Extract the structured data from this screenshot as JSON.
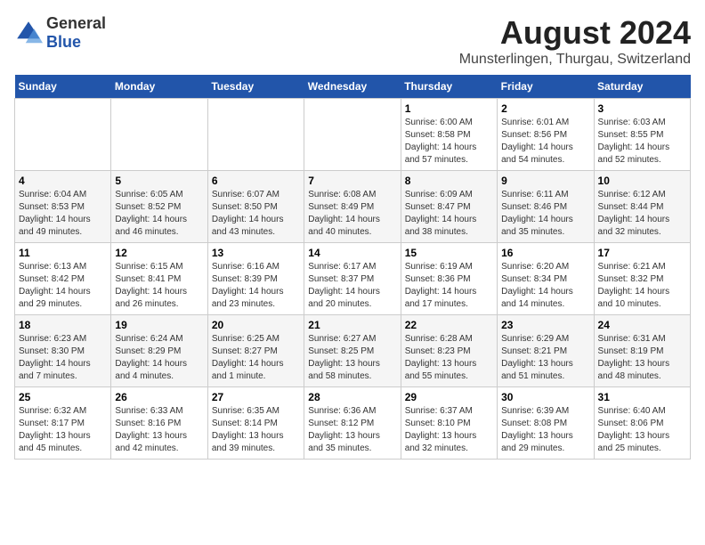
{
  "header": {
    "logo_general": "General",
    "logo_blue": "Blue",
    "title": "August 2024",
    "subtitle": "Munsterlingen, Thurgau, Switzerland"
  },
  "days_of_week": [
    "Sunday",
    "Monday",
    "Tuesday",
    "Wednesday",
    "Thursday",
    "Friday",
    "Saturday"
  ],
  "weeks": [
    [
      {
        "day": "",
        "info": ""
      },
      {
        "day": "",
        "info": ""
      },
      {
        "day": "",
        "info": ""
      },
      {
        "day": "",
        "info": ""
      },
      {
        "day": "1",
        "info": "Sunrise: 6:00 AM\nSunset: 8:58 PM\nDaylight: 14 hours\nand 57 minutes."
      },
      {
        "day": "2",
        "info": "Sunrise: 6:01 AM\nSunset: 8:56 PM\nDaylight: 14 hours\nand 54 minutes."
      },
      {
        "day": "3",
        "info": "Sunrise: 6:03 AM\nSunset: 8:55 PM\nDaylight: 14 hours\nand 52 minutes."
      }
    ],
    [
      {
        "day": "4",
        "info": "Sunrise: 6:04 AM\nSunset: 8:53 PM\nDaylight: 14 hours\nand 49 minutes."
      },
      {
        "day": "5",
        "info": "Sunrise: 6:05 AM\nSunset: 8:52 PM\nDaylight: 14 hours\nand 46 minutes."
      },
      {
        "day": "6",
        "info": "Sunrise: 6:07 AM\nSunset: 8:50 PM\nDaylight: 14 hours\nand 43 minutes."
      },
      {
        "day": "7",
        "info": "Sunrise: 6:08 AM\nSunset: 8:49 PM\nDaylight: 14 hours\nand 40 minutes."
      },
      {
        "day": "8",
        "info": "Sunrise: 6:09 AM\nSunset: 8:47 PM\nDaylight: 14 hours\nand 38 minutes."
      },
      {
        "day": "9",
        "info": "Sunrise: 6:11 AM\nSunset: 8:46 PM\nDaylight: 14 hours\nand 35 minutes."
      },
      {
        "day": "10",
        "info": "Sunrise: 6:12 AM\nSunset: 8:44 PM\nDaylight: 14 hours\nand 32 minutes."
      }
    ],
    [
      {
        "day": "11",
        "info": "Sunrise: 6:13 AM\nSunset: 8:42 PM\nDaylight: 14 hours\nand 29 minutes."
      },
      {
        "day": "12",
        "info": "Sunrise: 6:15 AM\nSunset: 8:41 PM\nDaylight: 14 hours\nand 26 minutes."
      },
      {
        "day": "13",
        "info": "Sunrise: 6:16 AM\nSunset: 8:39 PM\nDaylight: 14 hours\nand 23 minutes."
      },
      {
        "day": "14",
        "info": "Sunrise: 6:17 AM\nSunset: 8:37 PM\nDaylight: 14 hours\nand 20 minutes."
      },
      {
        "day": "15",
        "info": "Sunrise: 6:19 AM\nSunset: 8:36 PM\nDaylight: 14 hours\nand 17 minutes."
      },
      {
        "day": "16",
        "info": "Sunrise: 6:20 AM\nSunset: 8:34 PM\nDaylight: 14 hours\nand 14 minutes."
      },
      {
        "day": "17",
        "info": "Sunrise: 6:21 AM\nSunset: 8:32 PM\nDaylight: 14 hours\nand 10 minutes."
      }
    ],
    [
      {
        "day": "18",
        "info": "Sunrise: 6:23 AM\nSunset: 8:30 PM\nDaylight: 14 hours\nand 7 minutes."
      },
      {
        "day": "19",
        "info": "Sunrise: 6:24 AM\nSunset: 8:29 PM\nDaylight: 14 hours\nand 4 minutes."
      },
      {
        "day": "20",
        "info": "Sunrise: 6:25 AM\nSunset: 8:27 PM\nDaylight: 14 hours\nand 1 minute."
      },
      {
        "day": "21",
        "info": "Sunrise: 6:27 AM\nSunset: 8:25 PM\nDaylight: 13 hours\nand 58 minutes."
      },
      {
        "day": "22",
        "info": "Sunrise: 6:28 AM\nSunset: 8:23 PM\nDaylight: 13 hours\nand 55 minutes."
      },
      {
        "day": "23",
        "info": "Sunrise: 6:29 AM\nSunset: 8:21 PM\nDaylight: 13 hours\nand 51 minutes."
      },
      {
        "day": "24",
        "info": "Sunrise: 6:31 AM\nSunset: 8:19 PM\nDaylight: 13 hours\nand 48 minutes."
      }
    ],
    [
      {
        "day": "25",
        "info": "Sunrise: 6:32 AM\nSunset: 8:17 PM\nDaylight: 13 hours\nand 45 minutes."
      },
      {
        "day": "26",
        "info": "Sunrise: 6:33 AM\nSunset: 8:16 PM\nDaylight: 13 hours\nand 42 minutes."
      },
      {
        "day": "27",
        "info": "Sunrise: 6:35 AM\nSunset: 8:14 PM\nDaylight: 13 hours\nand 39 minutes."
      },
      {
        "day": "28",
        "info": "Sunrise: 6:36 AM\nSunset: 8:12 PM\nDaylight: 13 hours\nand 35 minutes."
      },
      {
        "day": "29",
        "info": "Sunrise: 6:37 AM\nSunset: 8:10 PM\nDaylight: 13 hours\nand 32 minutes."
      },
      {
        "day": "30",
        "info": "Sunrise: 6:39 AM\nSunset: 8:08 PM\nDaylight: 13 hours\nand 29 minutes."
      },
      {
        "day": "31",
        "info": "Sunrise: 6:40 AM\nSunset: 8:06 PM\nDaylight: 13 hours\nand 25 minutes."
      }
    ]
  ]
}
